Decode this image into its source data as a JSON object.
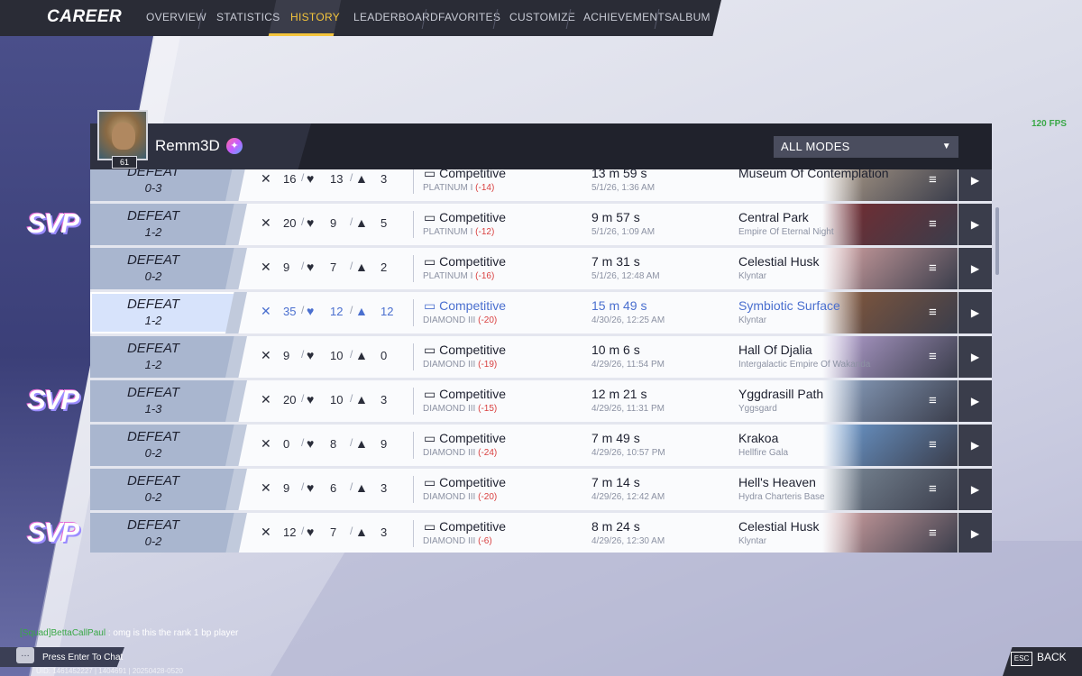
{
  "nav": {
    "title": "CAREER",
    "tabs": [
      "OVERVIEW",
      "STATISTICS",
      "HISTORY",
      "LEADERBOARD",
      "FAVORITES",
      "CUSTOMIZE",
      "ACHIEVEMENTS",
      "ALBUM"
    ],
    "active_tab": "HISTORY"
  },
  "fps": "120 FPS",
  "player": {
    "name": "Remm3D",
    "level": "61"
  },
  "filter": {
    "selected": "ALL MODES"
  },
  "matches": [
    {
      "result": "DEFEAT",
      "score": "0-3",
      "kills": "16",
      "deaths": "13",
      "assists": "3",
      "mode": "Competitive",
      "rank": "PLATINUM I",
      "delta": "(-14)",
      "duration": "13 m 59 s",
      "date": "5/1/26, 1:36 AM",
      "map": "Museum Of Contemplation",
      "sub": "",
      "svp": false,
      "selected": false,
      "thumb": "#b7a48e"
    },
    {
      "result": "DEFEAT",
      "score": "1-2",
      "kills": "20",
      "deaths": "9",
      "assists": "5",
      "mode": "Competitive",
      "rank": "PLATINUM I",
      "delta": "(-12)",
      "duration": "9 m 57 s",
      "date": "5/1/26, 1:09 AM",
      "map": "Central Park",
      "sub": "Empire Of Eternal Night",
      "svp": true,
      "selected": false,
      "thumb": "#7a2a2e"
    },
    {
      "result": "DEFEAT",
      "score": "0-2",
      "kills": "9",
      "deaths": "7",
      "assists": "2",
      "mode": "Competitive",
      "rank": "PLATINUM I",
      "delta": "(-16)",
      "duration": "7 m 31 s",
      "date": "5/1/26, 12:48 AM",
      "map": "Celestial Husk",
      "sub": "Klyntar",
      "svp": false,
      "selected": false,
      "thumb": "#d9a6a6"
    },
    {
      "result": "DEFEAT",
      "score": "1-2",
      "kills": "35",
      "deaths": "12",
      "assists": "12",
      "mode": "Competitive",
      "rank": "DIAMOND III",
      "delta": "(-20)",
      "duration": "15 m 49 s",
      "date": "4/30/26, 12:25 AM",
      "map": "Symbiotic Surface",
      "sub": "Klyntar",
      "svp": false,
      "selected": true,
      "thumb": "#8a5a3a"
    },
    {
      "result": "DEFEAT",
      "score": "1-2",
      "kills": "9",
      "deaths": "10",
      "assists": "0",
      "mode": "Competitive",
      "rank": "DIAMOND III",
      "delta": "(-19)",
      "duration": "10 m 6 s",
      "date": "4/29/26, 11:54 PM",
      "map": "Hall Of Djalia",
      "sub": "Intergalactic Empire Of Wakanda",
      "svp": false,
      "selected": false,
      "thumb": "#b9a4d6"
    },
    {
      "result": "DEFEAT",
      "score": "1-3",
      "kills": "20",
      "deaths": "10",
      "assists": "3",
      "mode": "Competitive",
      "rank": "DIAMOND III",
      "delta": "(-15)",
      "duration": "12 m 21 s",
      "date": "4/29/26, 11:31 PM",
      "map": "Yggdrasill Path",
      "sub": "Yggsgard",
      "svp": true,
      "selected": false,
      "thumb": "#8fa6c6"
    },
    {
      "result": "DEFEAT",
      "score": "0-2",
      "kills": "0",
      "deaths": "8",
      "assists": "9",
      "mode": "Competitive",
      "rank": "DIAMOND III",
      "delta": "(-24)",
      "duration": "7 m 49 s",
      "date": "4/29/26, 10:57 PM",
      "map": "Krakoa",
      "sub": "Hellfire Gala",
      "svp": false,
      "selected": false,
      "thumb": "#6f9fd6"
    },
    {
      "result": "DEFEAT",
      "score": "0-2",
      "kills": "9",
      "deaths": "6",
      "assists": "3",
      "mode": "Competitive",
      "rank": "DIAMOND III",
      "delta": "(-20)",
      "duration": "7 m 14 s",
      "date": "4/29/26, 12:42 AM",
      "map": "Hell's Heaven",
      "sub": "Hydra Charteris Base",
      "svp": false,
      "selected": false,
      "thumb": "#7f8e9c"
    },
    {
      "result": "DEFEAT",
      "score": "0-2",
      "kills": "12",
      "deaths": "7",
      "assists": "3",
      "mode": "Competitive",
      "rank": "DIAMOND III",
      "delta": "(-6)",
      "duration": "8 m 24 s",
      "date": "4/29/26, 12:30 AM",
      "map": "Celestial Husk",
      "sub": "Klyntar",
      "svp": true,
      "selected": false,
      "thumb": "#d9a6a6"
    }
  ],
  "svp_label": "SVP",
  "chat": {
    "channel": "[Squad]",
    "sender": "BettaCallPaul",
    "message": "omg is this the rank 1 bp player",
    "prompt": "Press Enter To Chat"
  },
  "uid": "UID: 1461452227 | 1404691 | 20250428-0520",
  "footer": {
    "esc": "ESC",
    "back": "BACK"
  }
}
